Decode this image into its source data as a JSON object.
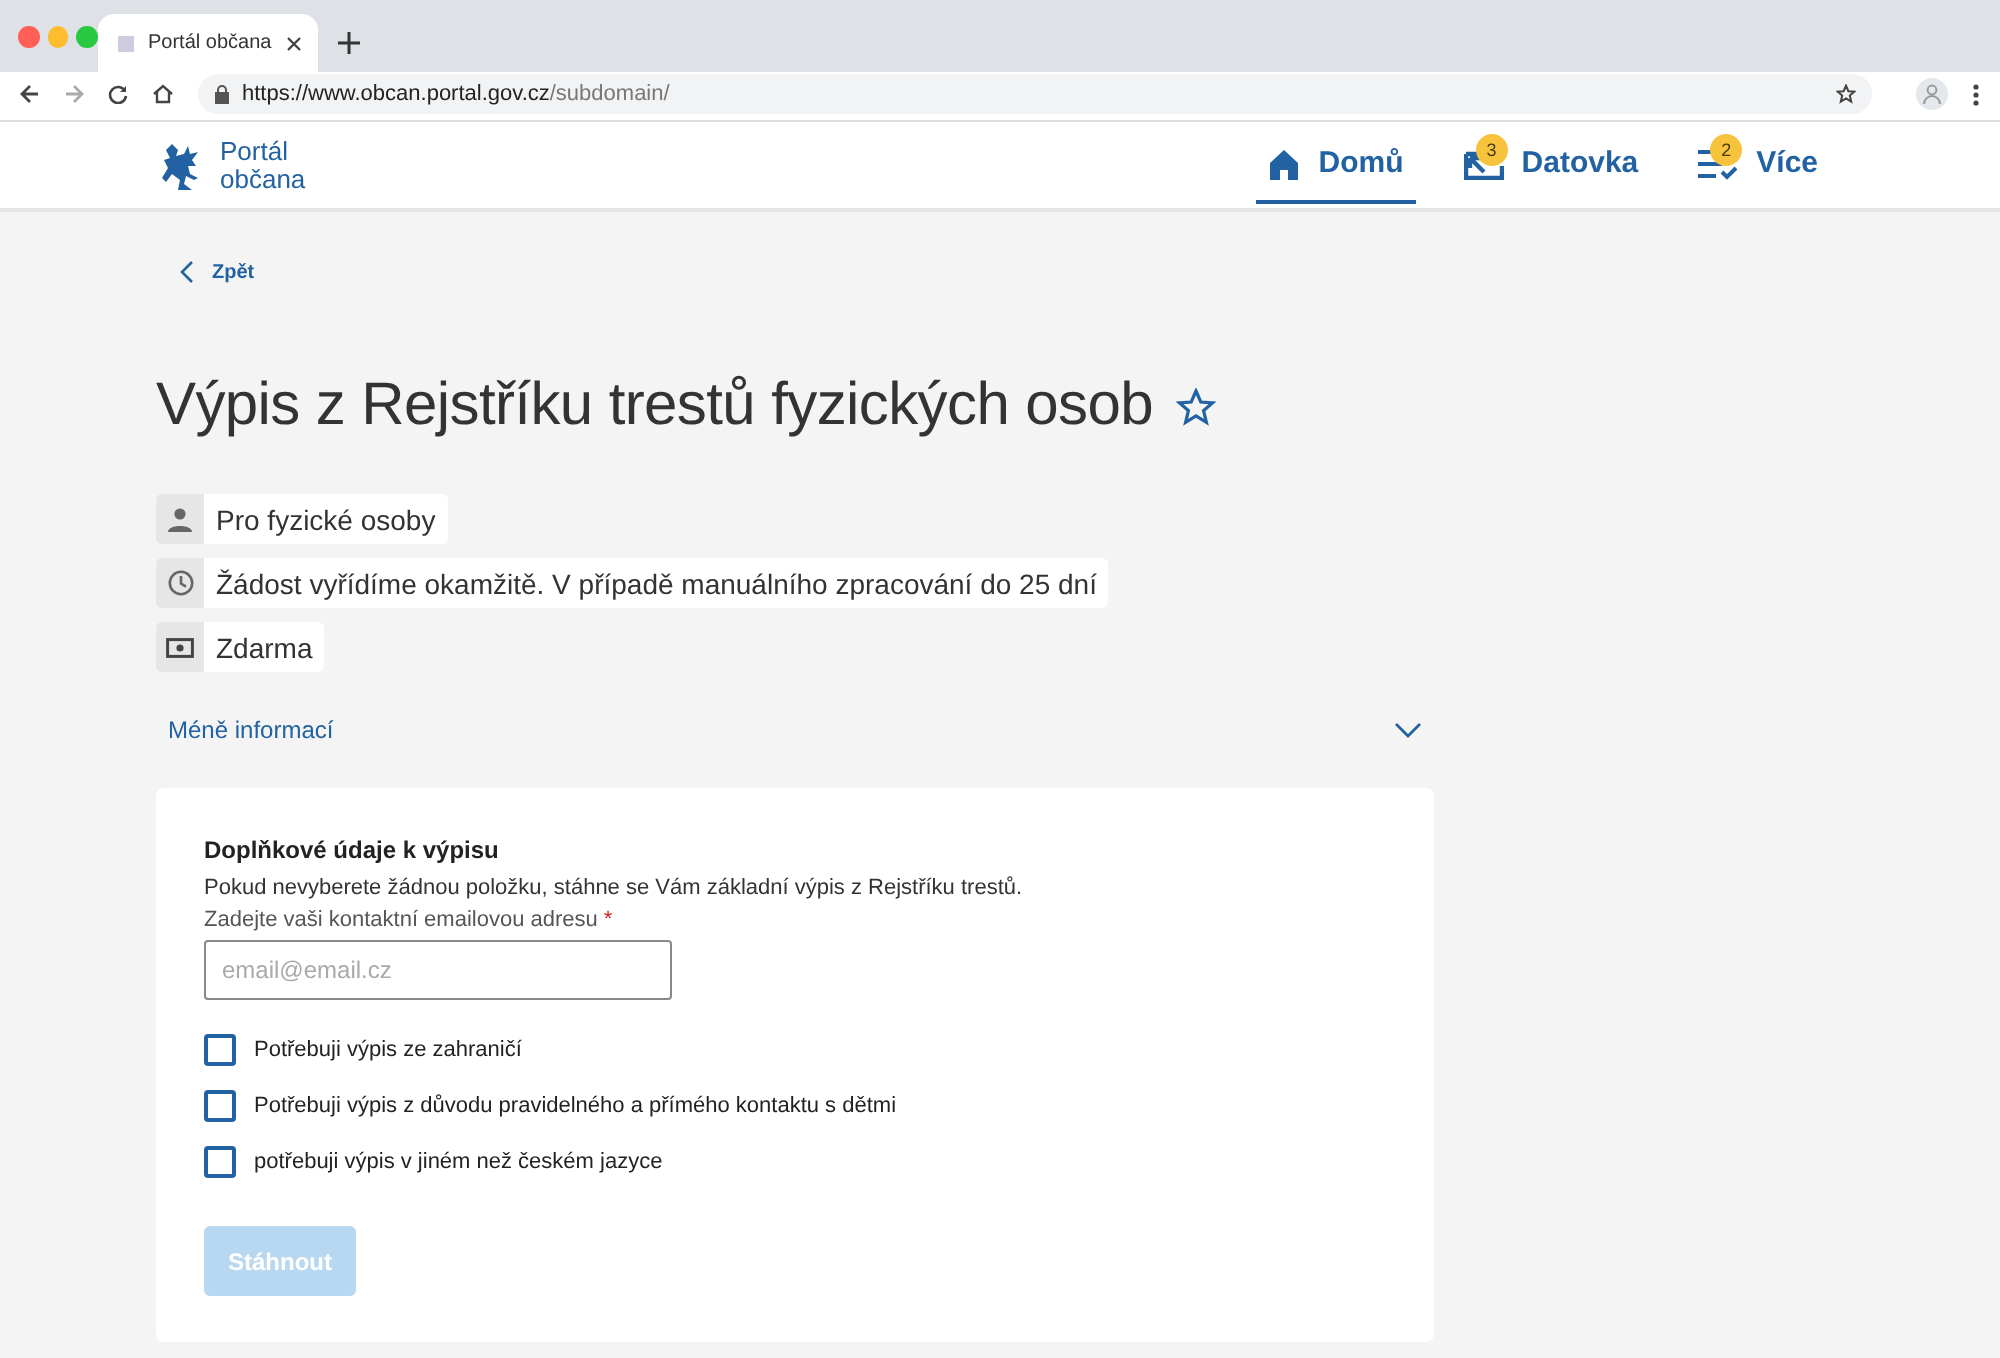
{
  "browser": {
    "tab_title": "Portál občana",
    "url_host": "https://www.obcan.portal.gov.cz",
    "url_path": "/subdomain/"
  },
  "header": {
    "logo_line_1": "Portál",
    "logo_line_2": "občana",
    "nav": [
      {
        "kind": "home",
        "label": "Domů",
        "selected": true
      },
      {
        "kind": "mailbox",
        "label": "Datovka",
        "badge": "3",
        "selected": false
      },
      {
        "kind": "list",
        "label": "Více",
        "badge": "2",
        "selected": false
      }
    ]
  },
  "back": "Zpět",
  "title": "Výpis z Rejstříku trestů fyzických osob",
  "favorite": false,
  "info": [
    {
      "kind": "person",
      "text": "Pro fyzické osoby"
    },
    {
      "kind": "clock",
      "text": "Žádost vyřídíme okamžitě. V případě manuálního zpracování do 25 dní"
    },
    {
      "kind": "money",
      "text": "Zdarma"
    }
  ],
  "toggle": {
    "label": "Méně informací",
    "expanded": true
  },
  "form": {
    "heading": "Doplňkové údaje k výpisu",
    "note": "Pokud nevyberete žádnou položku, stáhne se Vám základní výpis z Rejstříku trestů.",
    "email_label": "Zadejte vaši kontaktní emailovou adresu",
    "required_mark": "*",
    "email_placeholder": "email@email.cz",
    "options": [
      {
        "label": "Potřebuji výpis ze zahraničí",
        "checked": false
      },
      {
        "label": "Potřebuji výpis z důvodu pravidelného a přímého kontaktu s dětmi",
        "checked": false
      },
      {
        "label": "potřebuji výpis v jiném než českém jazyce",
        "checked": false
      }
    ],
    "submit": {
      "label": "Stáhnout",
      "disabled": true
    }
  }
}
